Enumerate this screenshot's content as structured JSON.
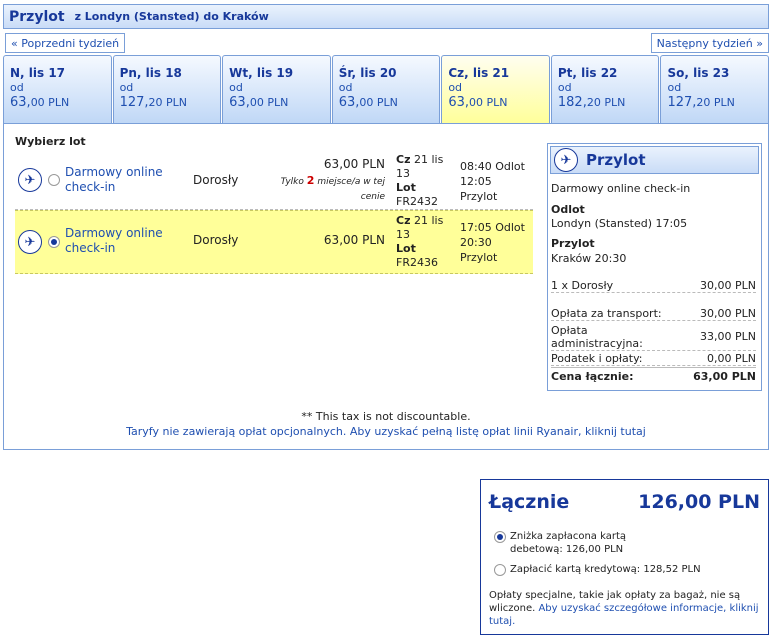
{
  "header": {
    "title": "Przylot",
    "subtitle": "z Londyn (Stansted) do Kraków"
  },
  "nav": {
    "prev_week": "« Poprzedni tydzień",
    "next_week": "Następny tydzień »"
  },
  "days": [
    {
      "name": "N, lis 17",
      "from": "od",
      "price_main": "63,",
      "price_dec": "00 PLN",
      "selected": false
    },
    {
      "name": "Pn, lis 18",
      "from": "od",
      "price_main": "127,",
      "price_dec": "20 PLN",
      "selected": false
    },
    {
      "name": "Wt, lis 19",
      "from": "od",
      "price_main": "63,",
      "price_dec": "00 PLN",
      "selected": false
    },
    {
      "name": "Śr, lis 20",
      "from": "od",
      "price_main": "63,",
      "price_dec": "00 PLN",
      "selected": false
    },
    {
      "name": "Cz, lis 21",
      "from": "od",
      "price_main": "63,",
      "price_dec": "00 PLN",
      "selected": true
    },
    {
      "name": "Pt, lis 22",
      "from": "od",
      "price_main": "182,",
      "price_dec": "20 PLN",
      "selected": false
    },
    {
      "name": "So, lis 23",
      "from": "od",
      "price_main": "127,",
      "price_dec": "20 PLN",
      "selected": false
    }
  ],
  "flights": {
    "heading": "Wybierz lot",
    "rows": [
      {
        "checkin": "Darmowy online check-in",
        "pax": "Dorosły",
        "fare": "63,00 PLN",
        "seats_pre": "Tylko",
        "seats_num": "2",
        "seats_post": "miejsce/a w tej cenie",
        "day": "Cz",
        "date": "21 lis 13",
        "lot_label": "Lot",
        "flight_no": "FR2432",
        "dep": "08:40 Odlot",
        "arr_time": "12:05",
        "arr_label": "Przylot",
        "selected": false
      },
      {
        "checkin": "Darmowy online check-in",
        "pax": "Dorosły",
        "fare": "63,00 PLN",
        "day": "Cz",
        "date": "21 lis 13",
        "lot_label": "Lot",
        "flight_no": "FR2436",
        "dep": "17:05 Odlot",
        "arr_time": "20:30",
        "arr_label": "Przylot",
        "selected": true
      }
    ]
  },
  "summary": {
    "title": "Przylot",
    "checkin": "Darmowy online check-in",
    "dep_label": "Odlot",
    "dep_value": "Londyn (Stansted) 17:05",
    "arr_label": "Przylot",
    "arr_value": "Kraków 20:30",
    "pax_label": "1 x Dorosły",
    "pax_value": "30,00 PLN",
    "transport_label": "Opłata za transport:",
    "transport_value": "30,00 PLN",
    "admin_label": "Opłata administracyjna:",
    "admin_value": "33,00 PLN",
    "tax_label": "Podatek i opłaty:",
    "tax_value": "0,00 PLN",
    "total_label": "Cena łącznie:",
    "total_value": "63,00 PLN"
  },
  "notes": {
    "tax": "** This tax is not discountable.",
    "fees_link": "Taryfy nie zawierają opłat opcjonalnych. Aby uzyskać pełną listę opłat linii Ryanair, kliknij tutaj"
  },
  "total": {
    "label": "Łącznie",
    "value": "126,00 PLN",
    "option1": "Zniżka zapłacona kartą debetową: 126,00 PLN",
    "option2": "Zapłacić kartą kredytową: 128,52 PLN",
    "note": "Opłaty specjalne, takie jak opłaty za bagaż, nie są wliczone.",
    "note_link": "Aby uzyskać szczegółowe informacje, kliknij tutaj."
  }
}
